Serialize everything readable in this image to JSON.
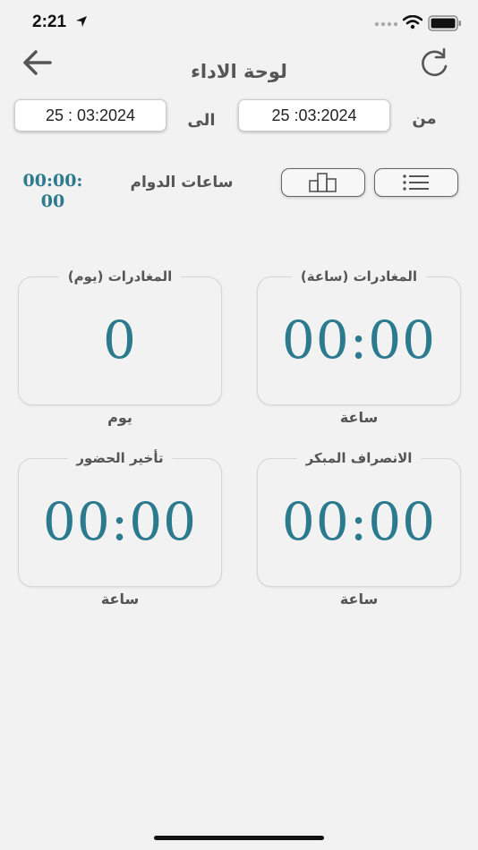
{
  "status_bar": {
    "time": "2:21"
  },
  "header": {
    "title": "لوحة الاداء"
  },
  "date_filter": {
    "from_label": "من",
    "from_value": "25 :03:2024",
    "to_label": "الى",
    "to_value": "25 : 03:2024"
  },
  "work_hours": {
    "label": "ساعات الدوام",
    "value": "00:00:00"
  },
  "cards": [
    {
      "title": "المغادرات (ساعة)",
      "value": "00:00",
      "unit": "ساعة"
    },
    {
      "title": "المغادرات (يوم)",
      "value": "0",
      "unit": "يوم"
    },
    {
      "title": "الانصراف المبكر",
      "value": "00:00",
      "unit": "ساعة"
    },
    {
      "title": "تأخير الحضور",
      "value": "00:00",
      "unit": "ساعة"
    }
  ],
  "colors": {
    "accent": "#2b7a8e",
    "background": "#f2f2f2",
    "label": "#555555"
  },
  "icons": {
    "back": "arrow-left-icon",
    "refresh": "refresh-icon",
    "chart": "bar-chart-icon",
    "list": "list-icon"
  }
}
